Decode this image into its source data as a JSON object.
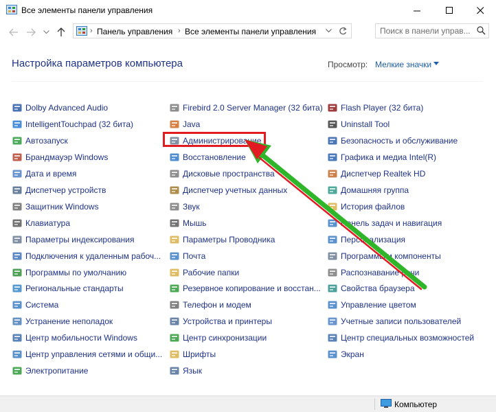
{
  "window": {
    "title": "Все элементы панели управления"
  },
  "address": {
    "crumbs": [
      "Панель управления",
      "Все элементы панели управления"
    ]
  },
  "search": {
    "placeholder": "Поиск в панели управ..."
  },
  "header": {
    "title": "Настройка параметров компьютера",
    "view_label": "Просмотр:",
    "view_value": "Мелкие значки"
  },
  "items": [
    [
      {
        "label": "Dolby Advanced Audio",
        "icon": "dolby-icon",
        "color": "#2a5aa6"
      },
      {
        "label": "IntelligentTouchpad (32 бита)",
        "icon": "touchpad-icon",
        "color": "#2b7bd1"
      },
      {
        "label": "Автозапуск",
        "icon": "autoplay-icon",
        "color": "#2e9a3e"
      },
      {
        "label": "Брандмауэр Windows",
        "icon": "firewall-icon",
        "color": "#b5442f"
      },
      {
        "label": "Дата и время",
        "icon": "clock-icon",
        "color": "#4d83c4"
      },
      {
        "label": "Диспетчер устройств",
        "icon": "device-manager-icon",
        "color": "#4f6a8a"
      },
      {
        "label": "Защитник Windows",
        "icon": "defender-icon",
        "color": "#6b6b6b"
      },
      {
        "label": "Клавиатура",
        "icon": "keyboard-icon",
        "color": "#5a5a5a"
      },
      {
        "label": "Параметры индексирования",
        "icon": "indexing-icon",
        "color": "#6a7b91"
      },
      {
        "label": "Подключения к удаленным рабоч...",
        "icon": "remote-icon",
        "color": "#3f74b8"
      },
      {
        "label": "Программы по умолчанию",
        "icon": "default-programs-icon",
        "color": "#2f8f3a"
      },
      {
        "label": "Региональные стандарты",
        "icon": "region-icon",
        "color": "#3a88c8"
      },
      {
        "label": "Система",
        "icon": "system-icon",
        "color": "#3d7fc4"
      },
      {
        "label": "Устранение неполадок",
        "icon": "troubleshoot-icon",
        "color": "#4a7fb8"
      },
      {
        "label": "Центр мобильности Windows",
        "icon": "mobility-icon",
        "color": "#3c6fa8"
      },
      {
        "label": "Центр управления сетями и общи...",
        "icon": "network-icon",
        "color": "#3e7fc0"
      },
      {
        "label": "Электропитание",
        "icon": "power-icon",
        "color": "#2f9a3a"
      }
    ],
    [
      {
        "label": "Firebird 2.0 Server Manager (32 бита)",
        "icon": "firebird-icon",
        "color": "#7a7a7a"
      },
      {
        "label": "Java",
        "icon": "java-icon",
        "color": "#d06a22"
      },
      {
        "label": "Администрирование",
        "icon": "admin-tools-icon",
        "color": "#6d7f95"
      },
      {
        "label": "Восстановление",
        "icon": "recovery-icon",
        "color": "#2f7ac8"
      },
      {
        "label": "Дисковые пространства",
        "icon": "storage-icon",
        "color": "#7a7a7a"
      },
      {
        "label": "Диспетчер учетных данных",
        "icon": "credential-icon",
        "color": "#a07a2a"
      },
      {
        "label": "Звук",
        "icon": "sound-icon",
        "color": "#7a7a7a"
      },
      {
        "label": "Мышь",
        "icon": "mouse-icon",
        "color": "#5a5a5a"
      },
      {
        "label": "Параметры Проводника",
        "icon": "explorer-options-icon",
        "color": "#d8b24a"
      },
      {
        "label": "Почта",
        "icon": "mail-icon",
        "color": "#3d7fc4"
      },
      {
        "label": "Рабочие папки",
        "icon": "work-folders-icon",
        "color": "#d8b24a"
      },
      {
        "label": "Резервное копирование и восстан...",
        "icon": "backup-icon",
        "color": "#2f9a3a"
      },
      {
        "label": "Телефон и модем",
        "icon": "phone-icon",
        "color": "#6a6a6a"
      },
      {
        "label": "Устройства и принтеры",
        "icon": "printer-icon",
        "color": "#4d6f96"
      },
      {
        "label": "Центр синхронизации",
        "icon": "sync-icon",
        "color": "#2f9a3a"
      },
      {
        "label": "Шрифты",
        "icon": "fonts-icon",
        "color": "#d8b24a"
      },
      {
        "label": "Язык",
        "icon": "language-icon",
        "color": "#4d6f96"
      }
    ],
    [
      {
        "label": "Flash Player (32 бита)",
        "icon": "flash-icon",
        "color": "#8c1b1b"
      },
      {
        "label": "Uninstall Tool",
        "icon": "uninstall-icon",
        "color": "#3a3a3a"
      },
      {
        "label": "Безопасность и обслуживание",
        "icon": "security-flag-icon",
        "color": "#2c5fa8"
      },
      {
        "label": "Графика и медиа Intel(R)",
        "icon": "intel-graphics-icon",
        "color": "#2a62b0"
      },
      {
        "label": "Диспетчер Realtek HD",
        "icon": "realtek-icon",
        "color": "#c46a2a"
      },
      {
        "label": "Домашняя группа",
        "icon": "homegroup-icon",
        "color": "#2f9a8a"
      },
      {
        "label": "История файлов",
        "icon": "file-history-icon",
        "color": "#d8b24a"
      },
      {
        "label": "Панель задач и навигация",
        "icon": "taskbar-icon",
        "color": "#3d7fc4"
      },
      {
        "label": "Персонализация",
        "icon": "personalization-icon",
        "color": "#3d7fc4"
      },
      {
        "label": "Программы и компоненты",
        "icon": "programs-icon",
        "color": "#6a7b91"
      },
      {
        "label": "Распознавание речи",
        "icon": "speech-icon",
        "color": "#7a7a7a"
      },
      {
        "label": "Свойства браузера",
        "icon": "browser-options-icon",
        "color": "#2f8f8a"
      },
      {
        "label": "Управление цветом",
        "icon": "color-management-icon",
        "color": "#3d7fc4"
      },
      {
        "label": "Учетные записи пользователей",
        "icon": "users-icon",
        "color": "#4d83c4"
      },
      {
        "label": "Центр специальных возможностей",
        "icon": "accessibility-icon",
        "color": "#3d6fa8"
      },
      {
        "label": "Экран",
        "icon": "display-icon",
        "color": "#3d7fc4"
      }
    ]
  ],
  "status": {
    "text": "Компьютер"
  },
  "colors": {
    "link": "#1e3287",
    "highlight": "#e21b23",
    "arrow": "#2fb52a"
  }
}
